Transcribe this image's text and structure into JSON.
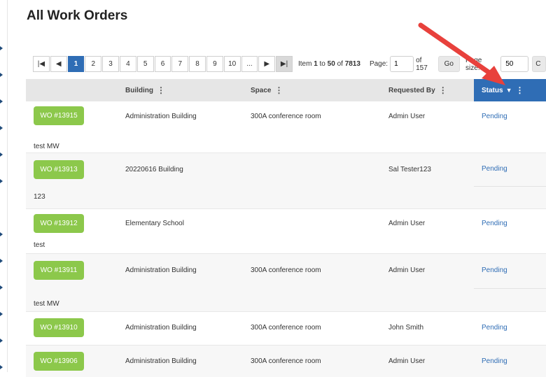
{
  "page": {
    "title": "All Work Orders"
  },
  "pager": {
    "pages": [
      "1",
      "2",
      "3",
      "4",
      "5",
      "6",
      "7",
      "8",
      "9",
      "10",
      "..."
    ],
    "first_icon": "first-page-icon",
    "prev_icon": "prev-page-icon",
    "next_icon": "next-page-icon",
    "last_icon": "last-page-icon",
    "item_label": "Item",
    "item_from": "1",
    "item_to_word": "to",
    "item_to": "50",
    "item_of_word": "of",
    "item_total": "7813",
    "page_label": "Page:",
    "page_value": "1",
    "page_of": "of 157",
    "go_label": "Go",
    "size_label": "Page size:",
    "size_value": "50"
  },
  "columns": {
    "building": "Building",
    "space": "Space",
    "requested_by": "Requested By",
    "status": "Status"
  },
  "rows": [
    {
      "wo": "WO #13915",
      "building": "Administration Building",
      "space": "300A conference room",
      "requested_by": "Admin User",
      "status": "Pending",
      "description": "test MW"
    },
    {
      "wo": "WO #13913",
      "building": "20220616 Building",
      "space": "",
      "requested_by": "Sal Tester123",
      "status": "Pending",
      "description": "123"
    },
    {
      "wo": "WO #13912",
      "building": "Elementary School",
      "space": "",
      "requested_by": "Admin User",
      "status": "Pending",
      "description": "test"
    },
    {
      "wo": "WO #13911",
      "building": "Administration Building",
      "space": "300A conference room",
      "requested_by": "Admin User",
      "status": "Pending",
      "description": "test MW"
    },
    {
      "wo": "WO #13910",
      "building": "Administration Building",
      "space": "300A conference room",
      "requested_by": "John Smith",
      "status": "Pending",
      "description": ""
    },
    {
      "wo": "WO #13906",
      "building": "Administration Building",
      "space": "300A conference room",
      "requested_by": "Admin User",
      "status": "Pending",
      "description": ""
    }
  ],
  "colors": {
    "accent": "#2f6db5",
    "wo_button": "#8cc84b",
    "annotation_arrow": "#e8413c",
    "header_bg": "#e6e6e6"
  },
  "icons": {
    "sort": "sort-down-icon",
    "menu": "column-menu-icon",
    "annotation": "red-arrow-annotation"
  }
}
